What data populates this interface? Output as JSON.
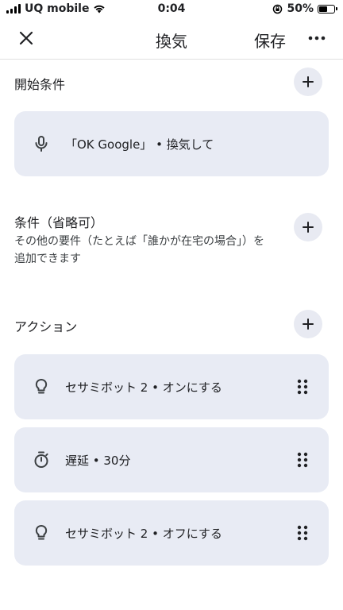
{
  "status_bar": {
    "carrier": "UQ mobile",
    "time": "0:04",
    "battery": "50%",
    "battery_level": 0.5
  },
  "app_bar": {
    "title": "換気",
    "save_label": "保存",
    "close_icon": "close-icon",
    "more_icon": "more-horizontal-icon"
  },
  "starters": {
    "title": "開始条件",
    "add_icon": "plus-icon",
    "items": [
      {
        "icon": "mic-icon",
        "text": "「OK Google」 • 換気して"
      }
    ]
  },
  "conditions": {
    "title": "条件（省略可）",
    "description_line1": "その他の要件（たとえば「誰かが在宅の場合」）を",
    "description_line2": "追加できます",
    "add_icon": "plus-icon"
  },
  "actions": {
    "title": "アクション",
    "add_icon": "plus-icon",
    "items": [
      {
        "icon": "lightbulb-icon",
        "text": "セサミボット 2 • オンにする"
      },
      {
        "icon": "timer-icon",
        "text": "遅延 • 30分"
      },
      {
        "icon": "lightbulb-icon",
        "text": "セサミボット 2 • オフにする"
      }
    ]
  }
}
